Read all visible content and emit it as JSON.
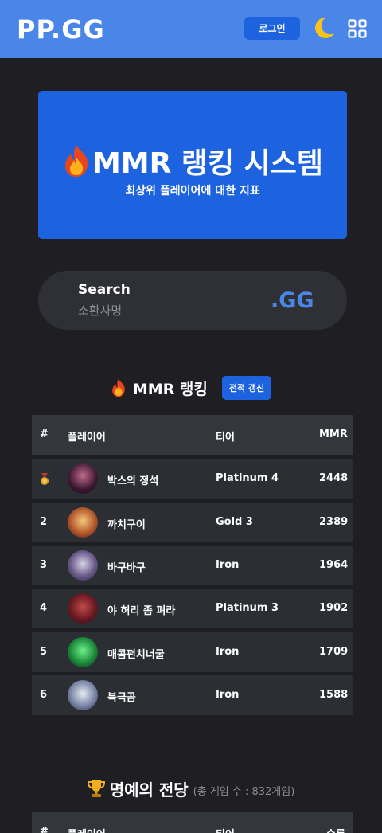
{
  "header": {
    "logo": "PP.GG",
    "login_label": "로그인"
  },
  "hero": {
    "title": "MMR 랭킹 시스템",
    "subtitle": "최상위 플레이어에 대한 지표"
  },
  "search": {
    "label": "Search",
    "placeholder": "소환사명",
    "gg_label": ".GG"
  },
  "ranking": {
    "title": "MMR 랭킹",
    "refresh_label": "전적 갱신",
    "columns": [
      "#",
      "플레이어",
      "티어",
      "MMR"
    ],
    "rows": [
      {
        "rank": "",
        "name": "박스의 정석",
        "tier": "Platinum 4",
        "mmr": "2448"
      },
      {
        "rank": "2",
        "name": "까치구이",
        "tier": "Gold 3",
        "mmr": "2389"
      },
      {
        "rank": "3",
        "name": "바구바구",
        "tier": "Iron",
        "mmr": "1964"
      },
      {
        "rank": "4",
        "name": "야 허리 좀 펴라",
        "tier": "Platinum 3",
        "mmr": "1902"
      },
      {
        "rank": "5",
        "name": "매콤펀치너굴",
        "tier": "Iron",
        "mmr": "1709"
      },
      {
        "rank": "6",
        "name": "북극곰",
        "tier": "Iron",
        "mmr": "1588"
      }
    ]
  },
  "hall": {
    "title": "명예의 전당",
    "subtitle": "(총 게임 수 : 832게임)",
    "columns": [
      "#",
      "플레이어",
      "티어",
      "승률"
    ]
  },
  "colors": {
    "header": "#4a86e8",
    "accent": "#1d63e0",
    "background": "#1f1f23"
  }
}
